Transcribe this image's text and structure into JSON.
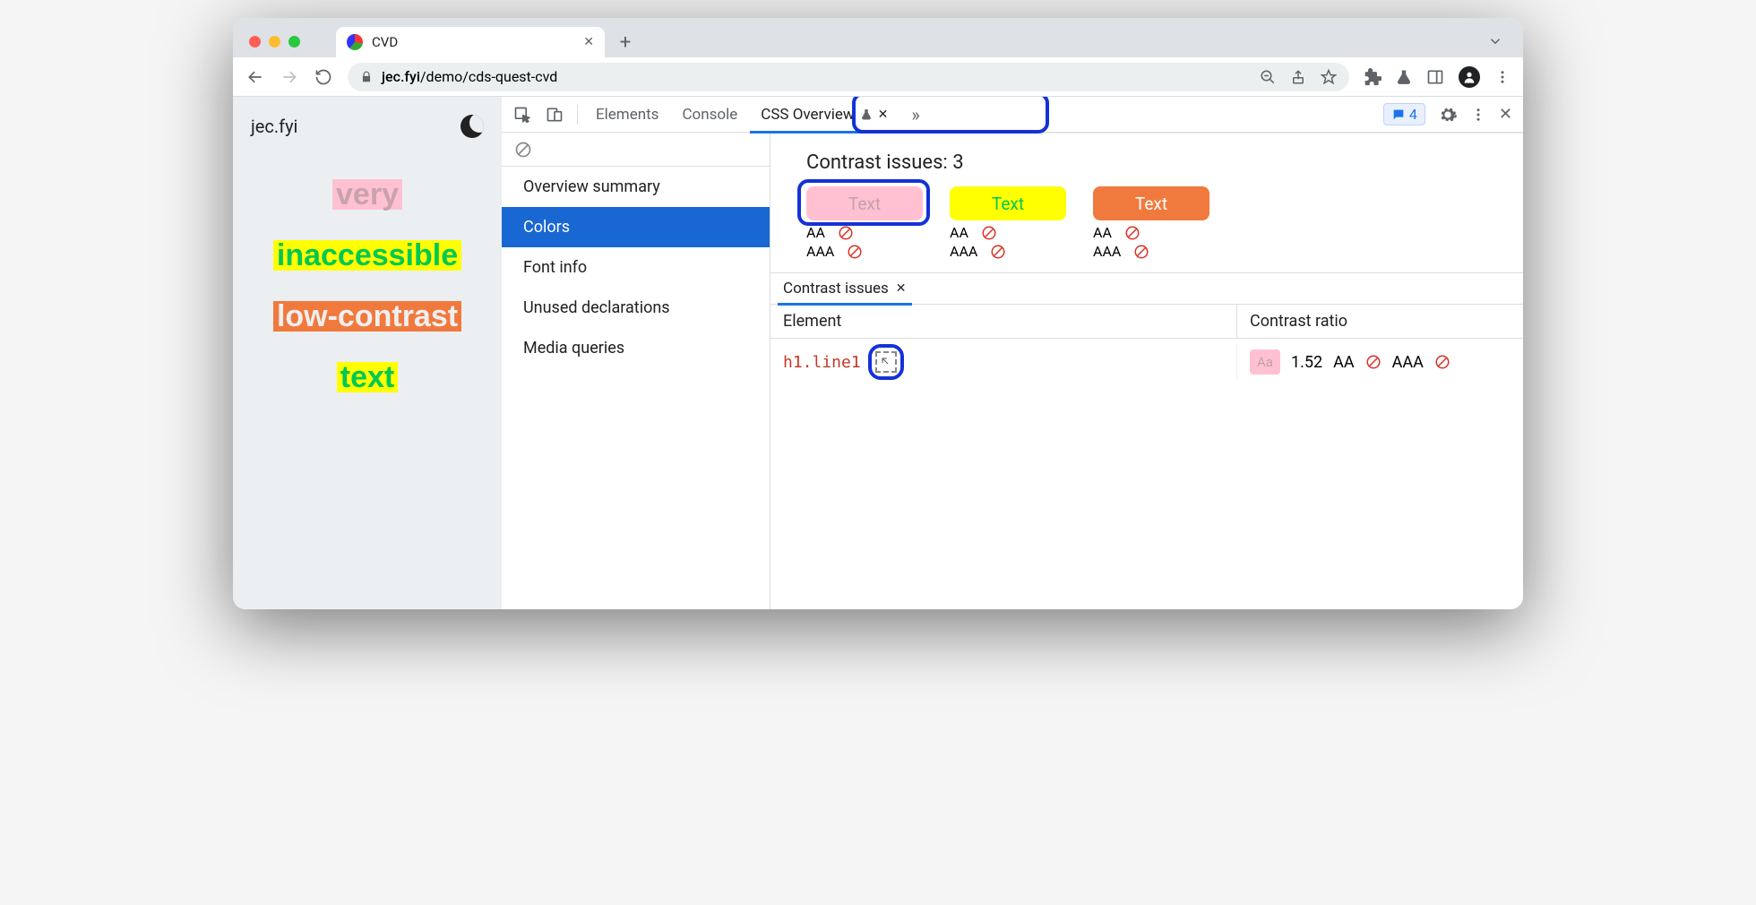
{
  "tab": {
    "title": "CVD"
  },
  "url": {
    "host": "jec.fyi",
    "path": "/demo/cds-quest-cvd"
  },
  "page": {
    "site": "jec.fyi",
    "lines": [
      "very",
      "inaccessible",
      "low-contrast",
      "text"
    ]
  },
  "devtools": {
    "tabs": {
      "elements": "Elements",
      "console": "Console",
      "cssoverview": "CSS Overview",
      "more": "»"
    },
    "msg_count": "4",
    "sidebar": {
      "items": [
        "Overview summary",
        "Colors",
        "Font info",
        "Unused declarations",
        "Media queries"
      ],
      "active_index": 1
    },
    "contrast_title": "Contrast issues: 3",
    "swatches": [
      {
        "label": "Text",
        "aa": "AA",
        "aaa": "AAA"
      },
      {
        "label": "Text",
        "aa": "AA",
        "aaa": "AAA"
      },
      {
        "label": "Text",
        "aa": "AA",
        "aaa": "AAA"
      }
    ],
    "subtab": "Contrast issues",
    "table": {
      "headers": {
        "element": "Element",
        "ratio": "Contrast ratio"
      },
      "row": {
        "element": "h1.line1",
        "sample": "Aa",
        "ratio": "1.52",
        "aa": "AA",
        "aaa": "AAA"
      }
    }
  }
}
